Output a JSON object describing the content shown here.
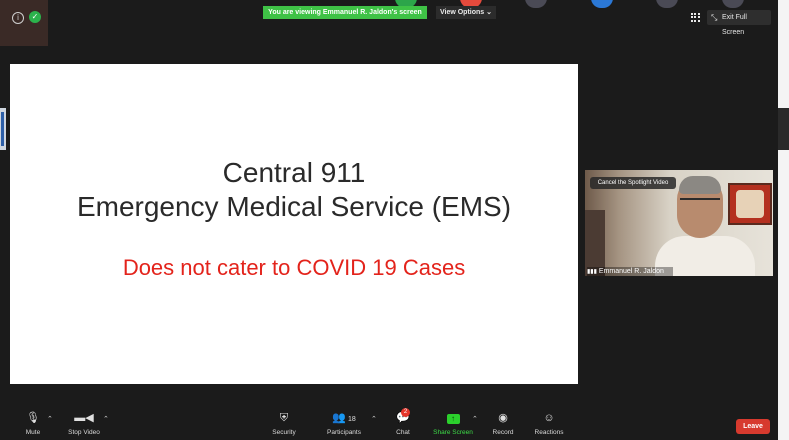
{
  "banner": {
    "text": "You are viewing Emmanuel R. Jaldon's screen"
  },
  "view_options": {
    "label": "View Options",
    "caret": "⌄"
  },
  "top_controls": {
    "exit_fullscreen": "Exit Full Screen"
  },
  "slide": {
    "line1": "Central 911",
    "line2": "Emergency Medical Service (EMS)",
    "line3": "Does not cater to COVID 19 Cases"
  },
  "video": {
    "cancel_spotlight": "Cancel the Spotlight Video",
    "participant_name": "Emmanuel R. Jaldon"
  },
  "toolbar": {
    "mute": "Mute",
    "stop_video": "Stop Video",
    "security": "Security",
    "participants": "Participants",
    "participants_count": "18",
    "chat": "Chat",
    "chat_badge": "2",
    "share_screen": "Share Screen",
    "record": "Record",
    "reactions": "Reactions",
    "leave": "Leave"
  },
  "colors": {
    "banner": "#3fc246",
    "leave": "#d73a2e",
    "slide_red": "#e3231b",
    "share_green": "#2bd02c"
  }
}
